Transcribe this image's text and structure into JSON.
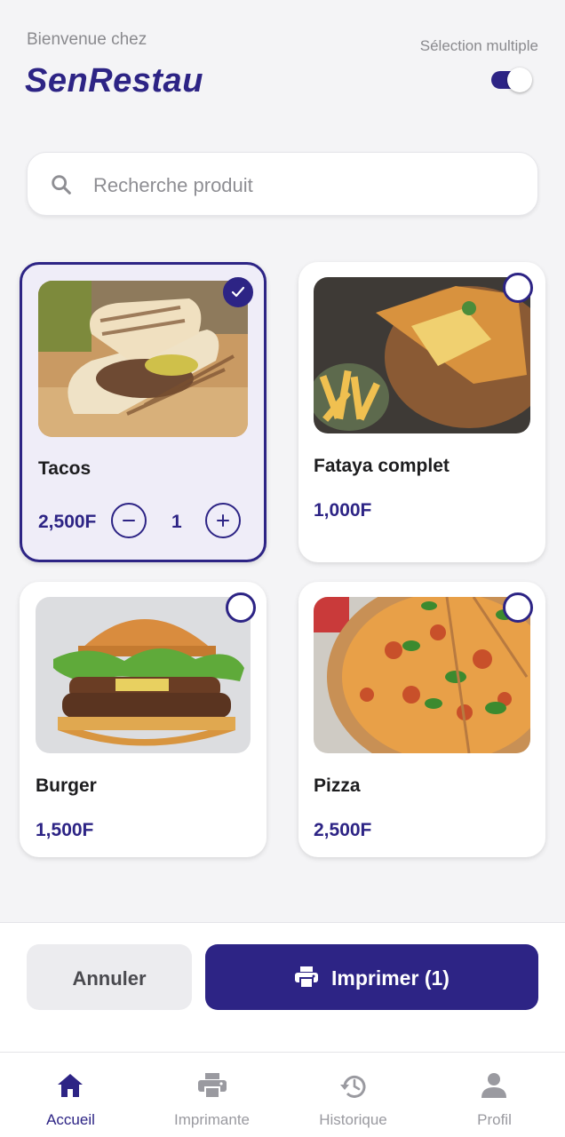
{
  "header": {
    "welcome": "Bienvenue chez",
    "brand": "SenRestau",
    "multi_select_label": "Sélection multiple",
    "multi_select_on": true
  },
  "search": {
    "placeholder": "Recherche produit",
    "icon": "search-icon"
  },
  "products": [
    {
      "name": "Tacos",
      "price": "2,500F",
      "selected": true,
      "quantity": "1"
    },
    {
      "name": "Fataya complet",
      "price": "1,000F",
      "selected": false
    },
    {
      "name": "Burger",
      "price": "1,500F",
      "selected": false
    },
    {
      "name": "Pizza",
      "price": "2,500F",
      "selected": false
    }
  ],
  "actions": {
    "cancel_label": "Annuler",
    "print_label": "Imprimer (1)"
  },
  "nav": {
    "items": [
      {
        "label": "Accueil",
        "icon": "home-icon",
        "active": true
      },
      {
        "label": "Imprimante",
        "icon": "printer-icon",
        "active": false
      },
      {
        "label": "Historique",
        "icon": "history-icon",
        "active": false
      },
      {
        "label": "Profil",
        "icon": "profile-icon",
        "active": false
      }
    ]
  },
  "colors": {
    "primary": "#2d2485",
    "background": "#f4f4f6",
    "selected_card": "#efedf8",
    "muted": "#8a8a8e"
  }
}
